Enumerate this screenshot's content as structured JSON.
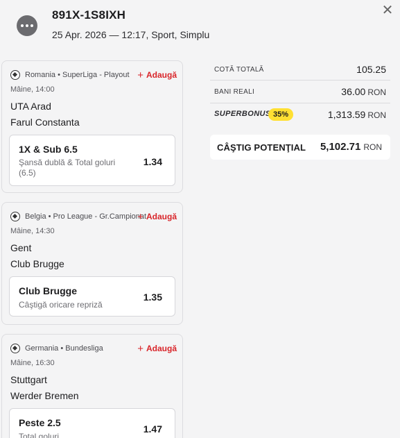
{
  "ticket": {
    "id": "891X-1S8IXH",
    "meta": "25 Apr. 2026 — 12:17, Sport, Simplu",
    "menu_icon": "more-dots-icon",
    "close_icon": "close-icon",
    "close_label": "✕"
  },
  "events": [
    {
      "league": "Romania • SuperLiga - Playout",
      "add_label": "Adaugă",
      "time": "Mâine, 14:00",
      "team1": "UTA Arad",
      "team2": "Farul Constanta",
      "bet_name": "1X & Sub 6.5",
      "bet_desc": "Şansă dublă & Total goluri (6.5)",
      "odd": "1.34"
    },
    {
      "league": "Belgia • Pro League - Gr.Campionat",
      "add_label": "Adaugă",
      "time": "Mâine, 14:30",
      "team1": "Gent",
      "team2": "Club Brugge",
      "bet_name": "Club Brugge",
      "bet_desc": "Câştigă oricare repriză",
      "odd": "1.35"
    },
    {
      "league": "Germania • Bundesliga",
      "add_label": "Adaugă",
      "time": "Mâine, 16:30",
      "team1": "Stuttgart",
      "team2": "Werder Bremen",
      "bet_name": "Peste 2.5",
      "bet_desc": "Total goluri",
      "odd": "1.47"
    }
  ],
  "summary": {
    "total_odds_label": "COTĂ TOTALĂ",
    "total_odds_value": "105.25",
    "real_money_label": "BANI REALI",
    "real_money_value": "36.00",
    "currency": "RON",
    "superbonus_label": "SUPERBONUS",
    "superbonus_percent": "35%",
    "superbonus_value": "1,313.59",
    "potential_label": "CÂŞTIG POTENŢIAL",
    "potential_value": "5,102.71"
  },
  "colors": {
    "accent_red": "#d9252a",
    "bonus_yellow": "#ffe033",
    "background": "#f4f4f5"
  }
}
